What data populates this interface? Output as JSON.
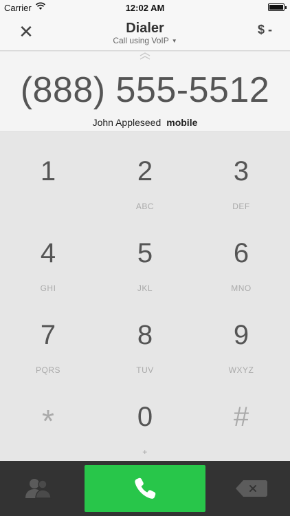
{
  "status_bar": {
    "carrier": "Carrier",
    "time": "12:02 AM",
    "wifi_icon": "wifi-icon",
    "battery_icon": "battery-icon"
  },
  "header": {
    "close_icon": "close-icon",
    "close_glyph": "✕",
    "title": "Dialer",
    "subtitle": "Call using VoIP",
    "subtitle_caret": "▼",
    "balance": "$ -"
  },
  "display": {
    "drag_handle_icon": "chevron-up-icon",
    "number": "(888) 555-5512",
    "contact_name": "John Appleseed",
    "contact_label": "mobile"
  },
  "keypad": {
    "keys": [
      {
        "digit": "1",
        "letters": ""
      },
      {
        "digit": "2",
        "letters": "ABC"
      },
      {
        "digit": "3",
        "letters": "DEF"
      },
      {
        "digit": "4",
        "letters": "GHI"
      },
      {
        "digit": "5",
        "letters": "JKL"
      },
      {
        "digit": "6",
        "letters": "MNO"
      },
      {
        "digit": "7",
        "letters": "PQRS"
      },
      {
        "digit": "8",
        "letters": "TUV"
      },
      {
        "digit": "9",
        "letters": "WXYZ"
      },
      {
        "digit": "*",
        "letters": ""
      },
      {
        "digit": "0",
        "letters": "+"
      },
      {
        "digit": "#",
        "letters": ""
      }
    ]
  },
  "bottom_bar": {
    "contacts_icon": "contacts-icon",
    "call_icon": "phone-icon",
    "backspace_icon": "backspace-icon",
    "call_color": "#28c64a",
    "bar_color": "#333333"
  }
}
